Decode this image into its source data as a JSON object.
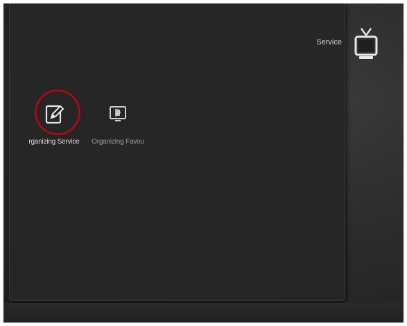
{
  "header": {
    "breadcrumb": "Service"
  },
  "menu": {
    "items": [
      {
        "label": "rganizing Service",
        "icon": "edit-icon",
        "selected": true
      },
      {
        "label": "Organizing Favou",
        "icon": "favourite-monitor-icon",
        "selected": false
      }
    ]
  },
  "colors": {
    "selection_ring": "#8a1620",
    "panel": "#262626",
    "background": "#2b2b2b"
  }
}
